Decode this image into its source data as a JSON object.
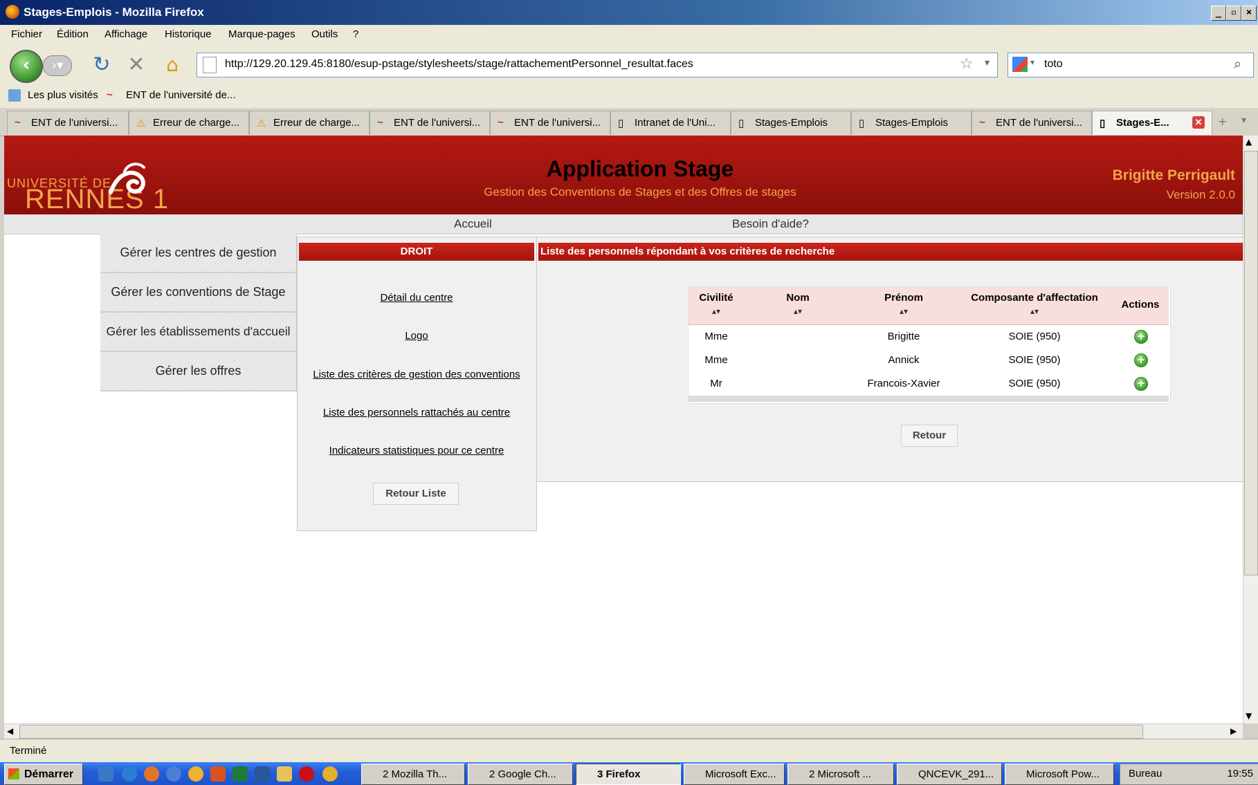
{
  "window": {
    "title": "Stages-Emplois - Mozilla Firefox"
  },
  "menu": [
    "Fichier",
    "Édition",
    "Affichage",
    "Historique",
    "Marque-pages",
    "Outils",
    "?"
  ],
  "nav": {
    "url": "http://129.20.129.45:8180/esup-pstage/stylesheets/stage/rattachementPersonnel_resultat.faces",
    "search": "toto"
  },
  "bookmarks": [
    "Les plus visités",
    "ENT de l'université de..."
  ],
  "tabs": [
    {
      "label": "ENT de l'universi...",
      "icon": "ent-icon"
    },
    {
      "label": "Erreur de charge...",
      "icon": "warning-icon"
    },
    {
      "label": "Erreur de charge...",
      "icon": "warning-icon"
    },
    {
      "label": "ENT de l'universi...",
      "icon": "ent-icon"
    },
    {
      "label": "ENT de l'universi...",
      "icon": "ent-icon"
    },
    {
      "label": "Intranet de l'Uni...",
      "icon": "page-icon"
    },
    {
      "label": "Stages-Emplois",
      "icon": "page-icon"
    },
    {
      "label": "Stages-Emplois",
      "icon": "page-icon"
    },
    {
      "label": "ENT de l'universi...",
      "icon": "ent-icon"
    },
    {
      "label": "Stages-E...",
      "icon": "page-icon",
      "active": true
    }
  ],
  "header": {
    "logo_top": "UNIVERSITÉ DE",
    "logo_main": "RENNES 1",
    "title": "Application Stage",
    "subtitle": "Gestion des Conventions de Stages et des Offres de stages",
    "user": "Brigitte Perrigault",
    "version": "Version 2.0.0"
  },
  "topnav": {
    "home": "Accueil",
    "help": "Besoin d'aide?"
  },
  "left_menu": [
    "Gérer les centres de gestion",
    "Gérer les conventions de Stage",
    "Gérer les établissements d'accueil",
    "Gérer les offres"
  ],
  "mid_panel": {
    "title": "DROIT",
    "links": [
      "Détail du centre",
      "Logo",
      "Liste des critères de gestion des conventions",
      "Liste des personnels rattachés au centre",
      "Indicateurs statistiques pour ce centre"
    ],
    "button": "Retour Liste"
  },
  "results": {
    "title": "Liste des personnels répondant à vos critères de recherche",
    "columns": [
      "Civilité",
      "Nom",
      "Prénom",
      "Composante d'affectation",
      "Actions"
    ],
    "rows": [
      {
        "civilite": "Mme",
        "nom": "",
        "prenom": "Brigitte",
        "composante": "SOIE (950)"
      },
      {
        "civilite": "Mme",
        "nom": "",
        "prenom": "Annick",
        "composante": "SOIE (950)"
      },
      {
        "civilite": "Mr",
        "nom": "",
        "prenom": "Francois-Xavier",
        "composante": "SOIE (950)"
      }
    ],
    "button": "Retour"
  },
  "status": "Terminé",
  "taskbar": {
    "start": "Démarrer",
    "buttons": [
      "2 Mozilla Th...",
      "2 Google Ch...",
      "3 Firefox",
      "Microsoft Exc...",
      "2 Microsoft ...",
      "QNCEVK_291...",
      "Microsoft Pow..."
    ],
    "tray_label": "Bureau",
    "clock": "19:55"
  },
  "colors": {
    "banner": "#a6140d",
    "accent": "#f4a44a",
    "header_row": "#f9dede"
  }
}
